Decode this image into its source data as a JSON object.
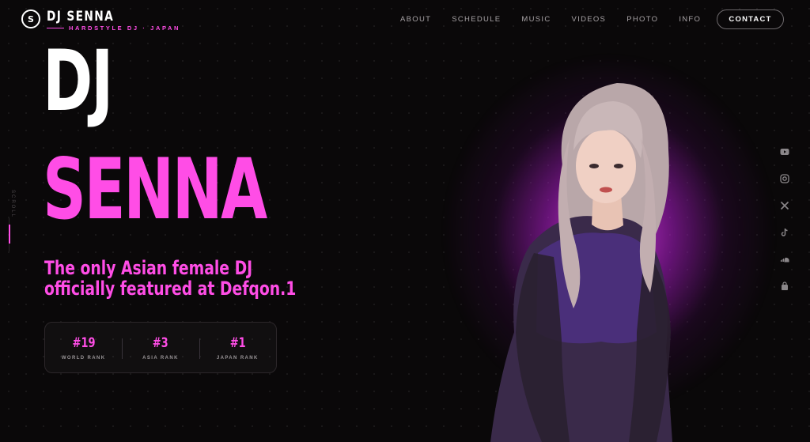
{
  "header": {
    "logo_mark": "S",
    "brand_name": "DJ SENNA",
    "brand_sub": "HARDSTYLE DJ · JAPAN",
    "nav": [
      "ABOUT",
      "SCHEDULE",
      "MUSIC",
      "VIDEOS",
      "PHOTO",
      "INFO"
    ],
    "contact_label": "CONTACT"
  },
  "scroll": {
    "label": "SCROLL"
  },
  "hero": {
    "line1": "DJ",
    "line2": "SENNA",
    "tagline_1": "The only Asian female DJ",
    "tagline_2": "officially featured at Defqon.1"
  },
  "ranks": [
    {
      "value": "#19",
      "label": "WORLD RANK"
    },
    {
      "value": "#3",
      "label": "ASIA RANK"
    },
    {
      "value": "#1",
      "label": "JAPAN RANK"
    }
  ],
  "social_icons": [
    "youtube-icon",
    "instagram-icon",
    "x-icon",
    "tiktok-icon",
    "soundcloud-icon",
    "shop-bag-icon"
  ],
  "colors": {
    "accent": "#ff4de6",
    "background": "#0a0809"
  }
}
